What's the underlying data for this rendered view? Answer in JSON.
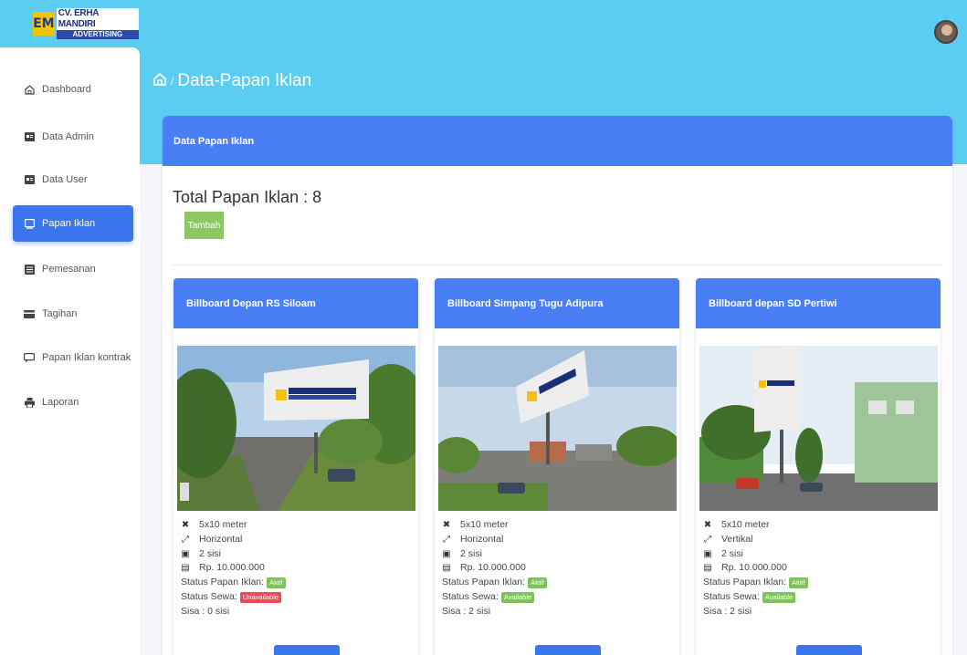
{
  "brand": {
    "logo_mark": "EM",
    "name_line1": "CV. ERHA MANDIRI",
    "name_line2": "ADVERTISING"
  },
  "sidebar": {
    "items": [
      {
        "label": "Dashboard",
        "icon": "home-icon"
      },
      {
        "label": "Data Admin",
        "icon": "id-card-icon"
      },
      {
        "label": "Data User",
        "icon": "id-card-icon"
      },
      {
        "label": "Papan Iklan",
        "icon": "monitor-icon",
        "active": true
      },
      {
        "label": "Pemesanan",
        "icon": "list-icon"
      },
      {
        "label": "Tagihan",
        "icon": "card-icon"
      },
      {
        "label": "Papan Iklan kontrak",
        "icon": "chat-icon"
      },
      {
        "label": "Laporan",
        "icon": "printer-icon"
      }
    ]
  },
  "header": {
    "breadcrumb_sep": "/",
    "page_title": "Data-Papan Iklan"
  },
  "main": {
    "card_title": "Data Papan Iklan",
    "total_label": "Total Papan Iklan : 8",
    "add_button": "Tambah"
  },
  "billboards": [
    {
      "title": "Billboard Depan RS Siloam",
      "size": "5x10 meter",
      "orientation": "Horizontal",
      "sides": "2 sisi",
      "price": "Rp. 10.000.000",
      "status_label": "Status Papan Iklan:",
      "status": "Aktif",
      "rent_label": "Status Sewa:",
      "rent": "Unavailable",
      "rent_color": "#f04a55",
      "remaining": "Sisa : 0 sisi"
    },
    {
      "title": "Billboard Simpang Tugu Adipura",
      "size": "5x10 meter",
      "orientation": "Horizontal",
      "sides": "2 sisi",
      "price": "Rp. 10.000.000",
      "status_label": "Status Papan Iklan:",
      "status": "Aktif",
      "rent_label": "Status Sewa:",
      "rent": "Available",
      "rent_color": "#7cc35a",
      "remaining": "Sisa : 2 sisi"
    },
    {
      "title": "Billboard depan SD Pertiwi",
      "size": "5x10 meter",
      "orientation": "Vertikal",
      "sides": "2 sisi",
      "price": "Rp. 10.000.000",
      "status_label": "Status Papan Iklan:",
      "status": "Aktif",
      "rent_label": "Status Sewa:",
      "rent": "Available",
      "rent_color": "#7cc35a",
      "remaining": "Sisa : 2 sisi"
    }
  ],
  "colors": {
    "topbar": "#5bcdf2",
    "primary": "#4a7ef5",
    "active_nav": "#3b76ef",
    "success": "#8cc763",
    "danger": "#f04a55"
  }
}
